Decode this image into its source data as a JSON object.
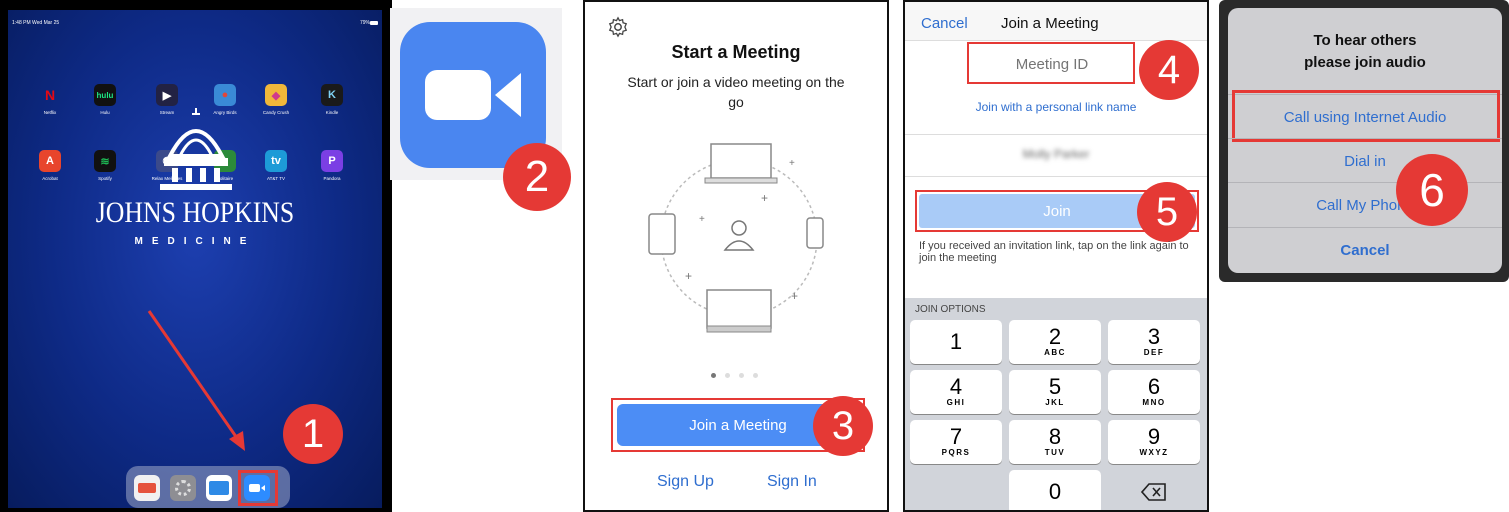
{
  "ipad": {
    "status_time": "1:48 PM  Wed Mar 25",
    "status_battery": "79%",
    "apps": [
      {
        "label": "Netflix",
        "glyph": "N",
        "color": "#111111"
      },
      {
        "label": "Hulu",
        "glyph": "hulu",
        "color": "#1ce783"
      },
      {
        "label": "Stream",
        "glyph": "▶",
        "color": "#222244"
      },
      {
        "label": "Angry Birds",
        "glyph": "●",
        "color": "#e0463a"
      },
      {
        "label": "Candy Crush",
        "glyph": "◆",
        "color": "#f0b73a"
      },
      {
        "label": "Kindle",
        "glyph": "K",
        "color": "#1a1a1a"
      },
      {
        "label": "Acrobat",
        "glyph": "A",
        "color": "#e8452c"
      },
      {
        "label": "Spotify",
        "glyph": "≋",
        "color": "#1db954"
      },
      {
        "label": "Relax Melodies",
        "glyph": "☾",
        "color": "#3b4a8a"
      },
      {
        "label": "Solitaire",
        "glyph": "♠",
        "color": "#2c8a3a"
      },
      {
        "label": "AT&T TV",
        "glyph": "tv",
        "color": "#1d9bd7"
      },
      {
        "label": "Pandora",
        "glyph": "P",
        "color": "#7b3fe4"
      }
    ],
    "logo_title": "JOHNS HOPKINS",
    "logo_subtitle": "MEDICINE",
    "step": "1"
  },
  "zoom_icon": {
    "step": "2",
    "color": "#4a86f0"
  },
  "start_screen": {
    "title": "Start a Meeting",
    "subtitle": "Start or join a video meeting on the go",
    "join_button": "Join a Meeting",
    "sign_up": "Sign Up",
    "sign_in": "Sign In",
    "step": "3"
  },
  "join_screen": {
    "cancel": "Cancel",
    "title": "Join a Meeting",
    "meeting_id_placeholder": "Meeting ID",
    "personal_link": "Join with a personal link name",
    "name_value": "Molly Parker",
    "join_button": "Join",
    "invite_note": "If you received an invitation link, tap on the link again to join the meeting",
    "join_options": "JOIN OPTIONS",
    "keys": [
      {
        "num": "1",
        "letters": ""
      },
      {
        "num": "2",
        "letters": "ABC"
      },
      {
        "num": "3",
        "letters": "DEF"
      },
      {
        "num": "4",
        "letters": "GHI"
      },
      {
        "num": "5",
        "letters": "JKL"
      },
      {
        "num": "6",
        "letters": "MNO"
      },
      {
        "num": "7",
        "letters": "PQRS"
      },
      {
        "num": "8",
        "letters": "TUV"
      },
      {
        "num": "9",
        "letters": "WXYZ"
      },
      {
        "num": "0",
        "letters": ""
      }
    ],
    "step_id": "4",
    "step_join": "5"
  },
  "audio_dialog": {
    "title_line1": "To hear others",
    "title_line2": "please join audio",
    "internet_audio": "Call using Internet Audio",
    "dial_in": "Dial in",
    "call_my_phone": "Call My Phone",
    "cancel": "Cancel",
    "step": "6"
  }
}
